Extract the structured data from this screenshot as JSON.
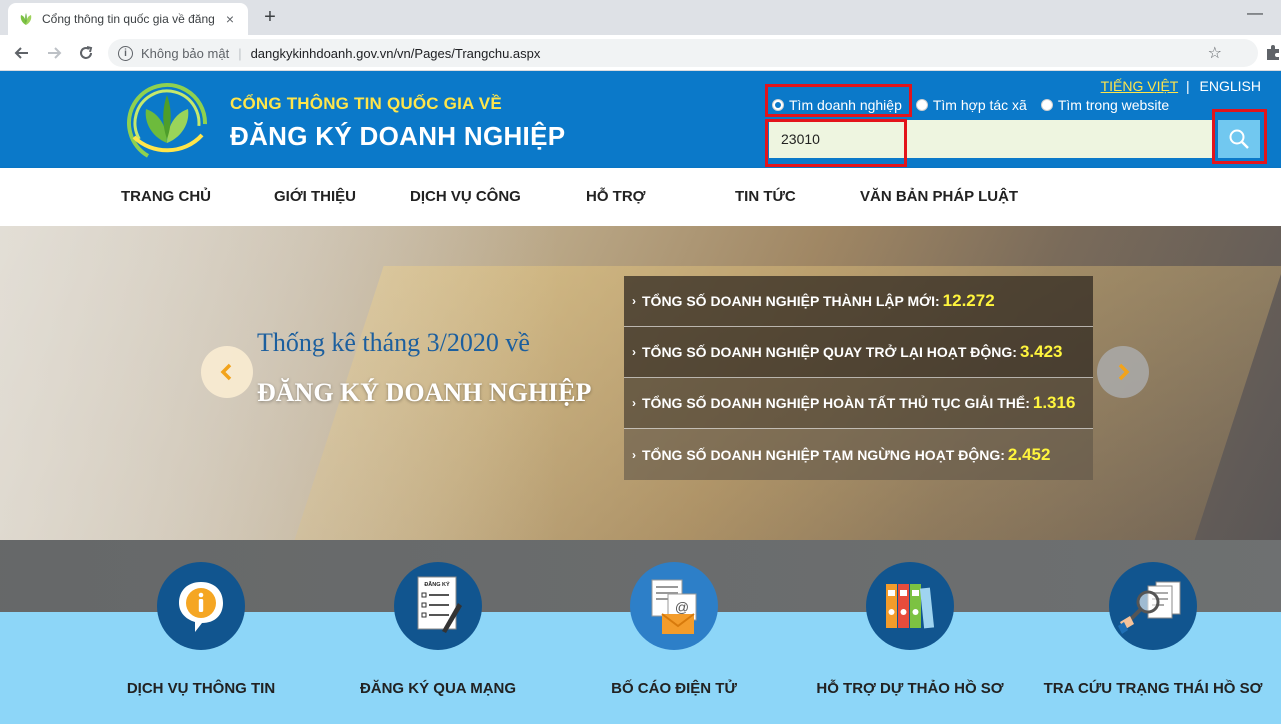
{
  "browser": {
    "tab_title": "Cổng thông tin quốc gia về đăng",
    "close_glyph": "×",
    "new_tab_glyph": "+",
    "minimize_glyph": "—",
    "insecure_label": "Không bảo mật",
    "url": "dangkykinhdoanh.gov.vn/vn/Pages/Trangchu.aspx"
  },
  "header": {
    "subtitle": "CỔNG THÔNG TIN QUỐC GIA VỀ",
    "title": "ĐĂNG KÝ DOANH NGHIỆP",
    "lang_vi": "TIẾNG VIỆT",
    "lang_sep": "|",
    "lang_en": "ENGLISH",
    "search_options": [
      {
        "label": "Tìm doanh nghiệp",
        "selected": true
      },
      {
        "label": "Tìm hợp tác xã",
        "selected": false
      },
      {
        "label": "Tìm trong website",
        "selected": false
      }
    ],
    "search_value": "23010",
    "accent_color": "#0b79c9",
    "highlight_color": "#e3141b"
  },
  "menu": [
    "TRANG CHỦ",
    "GIỚI THIỆU",
    "DỊCH VỤ CÔNG",
    "HỖ TRỢ",
    "TIN TỨC",
    "VĂN BẢN PHÁP LUẬT"
  ],
  "banner": {
    "heading": "Thống kê tháng 3/2020 về",
    "title": "ĐĂNG KÝ DOANH NGHIỆP",
    "stats": [
      {
        "label": "TỔNG SỐ DOANH NGHIỆP THÀNH LẬP MỚI:",
        "value": "12.272"
      },
      {
        "label": "TỔNG SỐ DOANH NGHIỆP QUAY TRỞ LẠI HOẠT ĐỘNG:",
        "value": "3.423"
      },
      {
        "label": "TỔNG SỐ DOANH NGHIỆP HOÀN TẤT THỦ TỤC GIẢI THỂ:",
        "value": "1.316"
      },
      {
        "label": "TỔNG SỐ DOANH NGHIỆP TẠM NGỪNG HOẠT ĐỘNG:",
        "value": "2.452"
      }
    ]
  },
  "services": [
    {
      "label": "DỊCH VỤ THÔNG TIN",
      "icon": "info-bubble-icon"
    },
    {
      "label": "ĐĂNG KÝ QUA MẠNG",
      "icon": "registration-form-icon",
      "icon_text": "ĐĂNG KÝ"
    },
    {
      "label": "BỐ CÁO ĐIỆN TỬ",
      "icon": "email-document-icon"
    },
    {
      "label": "HỖ TRỢ DỰ THẢO HỒ SƠ",
      "icon": "binders-icon"
    },
    {
      "label": "TRA CỨU TRẠNG THÁI HỒ SƠ",
      "icon": "magnifier-document-icon"
    }
  ]
}
